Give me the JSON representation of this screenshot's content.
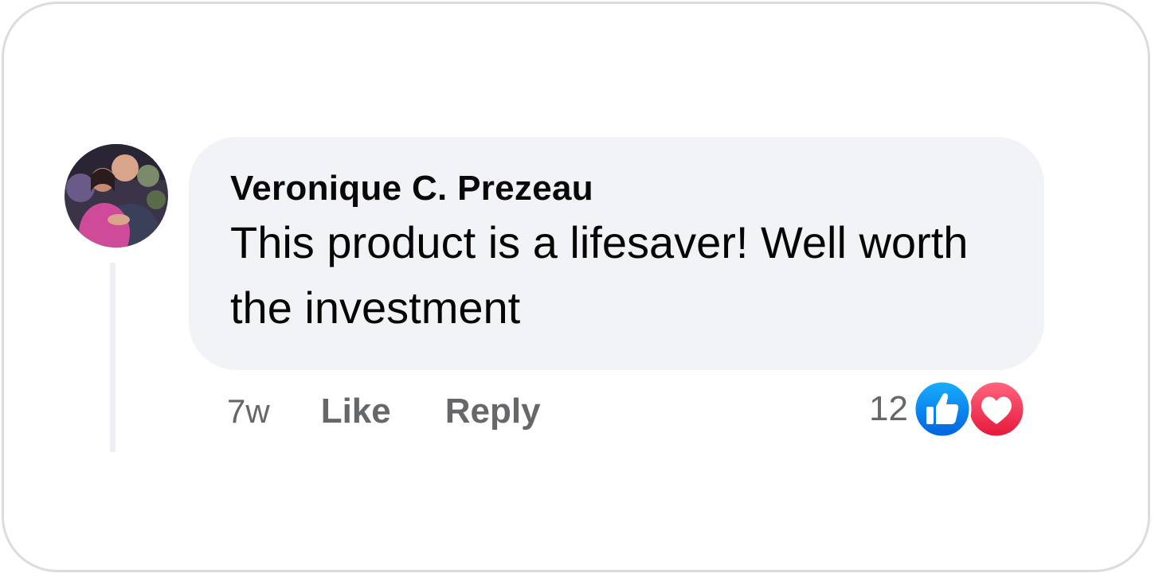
{
  "comment": {
    "author": "Veronique C. Prezeau",
    "text": "This product is a lifesaver! Well worth the investment",
    "timestamp": "7w",
    "like_label": "Like",
    "reply_label": "Reply",
    "reaction_count": "12",
    "reactions": [
      "like-icon",
      "love-icon"
    ]
  },
  "colors": {
    "bubble_bg": "#f2f3f6",
    "secondary_text": "#65676b",
    "like_blue": "#1877f2",
    "love_red": "#f33e58"
  }
}
